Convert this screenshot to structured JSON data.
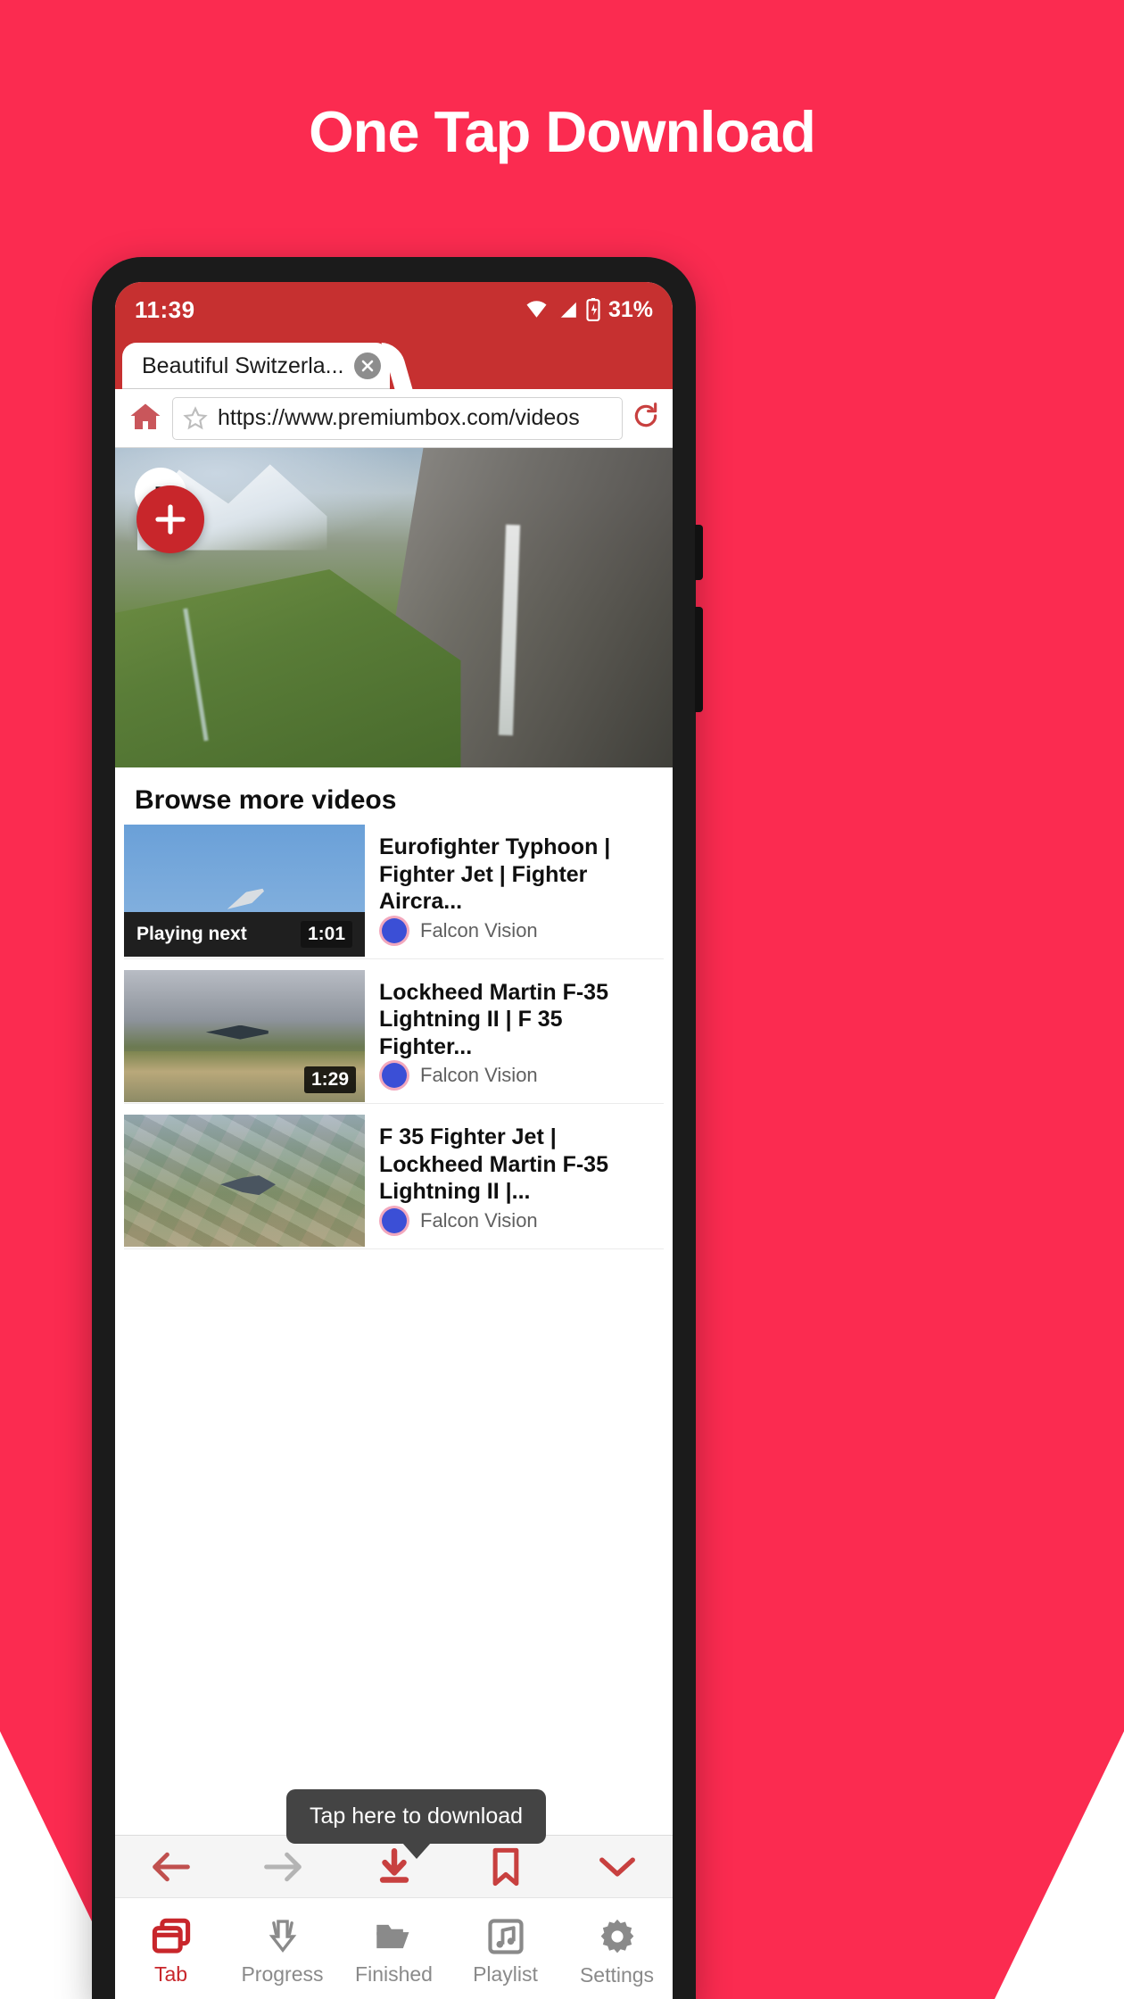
{
  "promo": {
    "title": "One Tap Download",
    "bg_color": "#FB2B50",
    "accent_color": "#C8262B"
  },
  "status_bar": {
    "time": "11:39",
    "battery_percent": "31%",
    "icons": [
      "wifi-icon",
      "signal-icon",
      "battery-icon"
    ]
  },
  "browser": {
    "tab": {
      "title": "Beautiful Switzerla...",
      "close_icon": "close-icon"
    },
    "address_bar": {
      "home_icon": "home-icon",
      "bookmark_icon": "star-icon",
      "url": "https://www.premiumbox.com/videos",
      "reload_icon": "reload-icon"
    },
    "fab": {
      "plus_label": "+"
    },
    "nav": [
      {
        "name": "back",
        "icon": "arrow-left-icon",
        "color": "#C0504E",
        "active": true
      },
      {
        "name": "forward",
        "icon": "arrow-right-icon",
        "color": "#B4B4B4",
        "active": false
      },
      {
        "name": "download",
        "icon": "download-icon",
        "color": "#C8403F",
        "active": true
      },
      {
        "name": "bookmarks",
        "icon": "bookmark-icon",
        "color": "#C8403F",
        "active": true
      },
      {
        "name": "collapse",
        "icon": "chevron-down-icon",
        "color": "#C8403F",
        "active": true
      }
    ]
  },
  "page": {
    "browse_heading": "Browse more videos",
    "videos": [
      {
        "title": "Eurofighter Typhoon | Fighter Jet | Fighter Aircra...",
        "channel": "Falcon Vision",
        "duration": "1:01",
        "badge": "Playing next",
        "has_badge_bar": true
      },
      {
        "title": "Lockheed Martin F-35 Lightning II | F 35 Fighter...",
        "channel": "Falcon Vision",
        "duration": "1:29",
        "badge": "",
        "has_badge_bar": false
      },
      {
        "title": "F 35 Fighter Jet | Lockheed Martin F-35 Lightning II |...",
        "channel": "Falcon Vision",
        "duration": "",
        "badge": "",
        "has_badge_bar": false
      }
    ]
  },
  "tooltip": {
    "text": "Tap here to download"
  },
  "tabbar": [
    {
      "label": "Tab",
      "icon": "tabs-icon",
      "active": true
    },
    {
      "label": "Progress",
      "icon": "download-progress-icon",
      "active": false
    },
    {
      "label": "Finished",
      "icon": "folder-icon",
      "active": false
    },
    {
      "label": "Playlist",
      "icon": "music-list-icon",
      "active": false
    },
    {
      "label": "Settings",
      "icon": "gear-icon",
      "active": false
    }
  ]
}
